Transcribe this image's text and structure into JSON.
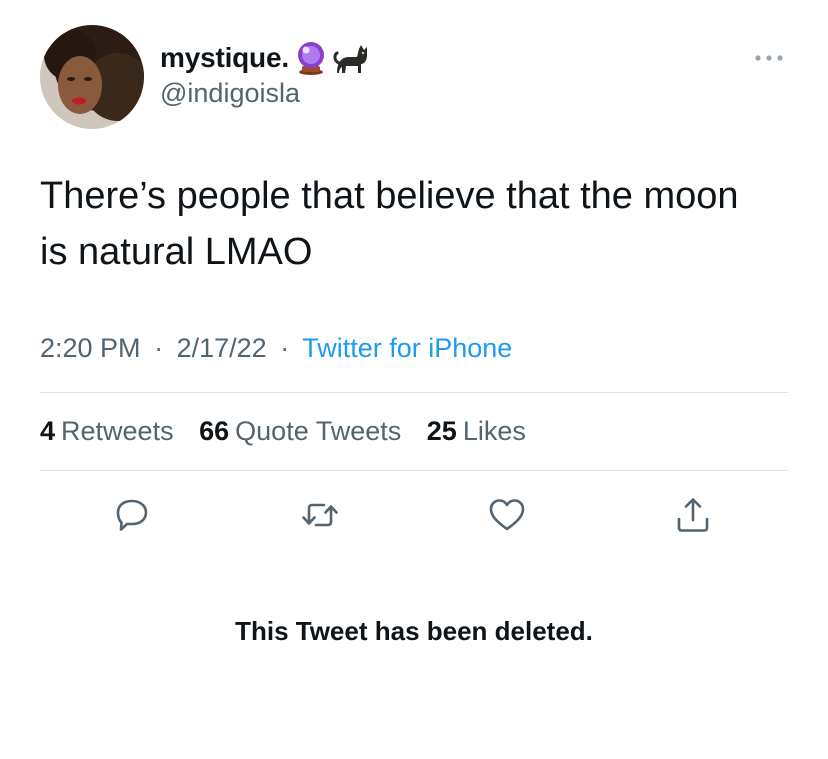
{
  "author": {
    "display_name": "mystique.",
    "name_emojis": [
      "crystal-ball-icon",
      "black-cat-icon"
    ],
    "handle": "@indigoisla"
  },
  "tweet": {
    "text": "There’s people that believe that the moon is natural LMAO",
    "time": "2:20 PM",
    "date": "2/17/22",
    "separator": "·",
    "source": "Twitter for iPhone"
  },
  "stats": {
    "retweets_count": "4",
    "retweets_label": "Retweets",
    "quotes_count": "66",
    "quotes_label": "Quote Tweets",
    "likes_count": "25",
    "likes_label": "Likes"
  },
  "actions": [
    "reply-icon",
    "retweet-icon",
    "like-icon",
    "share-icon"
  ],
  "quoted_tweet_status": "This Tweet has been deleted.",
  "colors": {
    "text_primary": "#0f1419",
    "text_secondary": "#536471",
    "link": "#1d9bf0",
    "divider": "#dfe3e6"
  }
}
